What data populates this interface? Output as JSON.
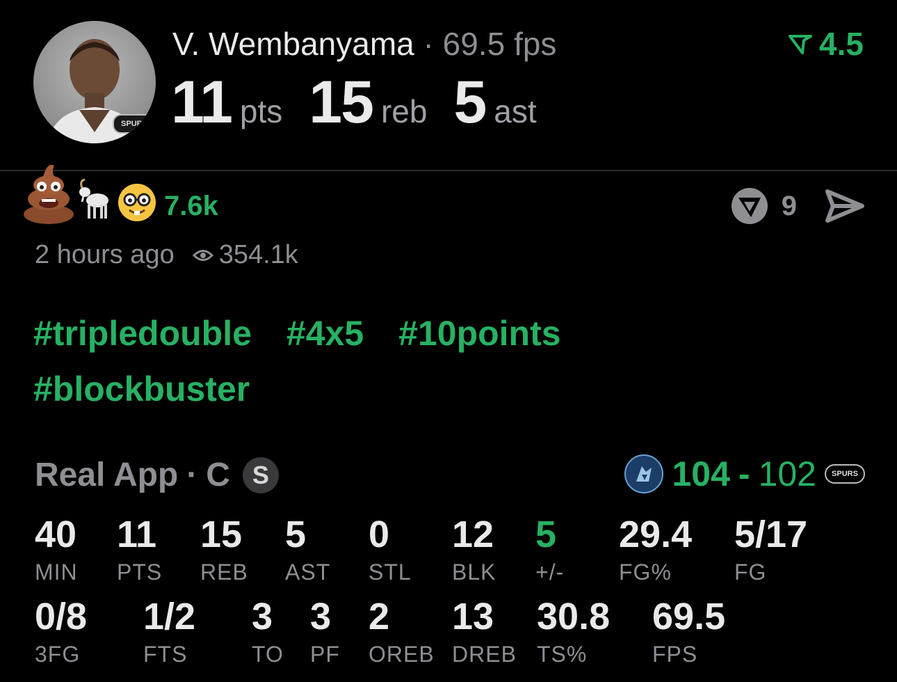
{
  "header": {
    "player_name": "V. Wembanyama",
    "separator": "·",
    "fps_label": "69.5 fps",
    "boost_value": "4.5",
    "stats": [
      {
        "value": "11",
        "unit": "pts"
      },
      {
        "value": "15",
        "unit": "reb"
      },
      {
        "value": "5",
        "unit": "ast"
      }
    ],
    "team_logo_text": "SPURS"
  },
  "reactions": {
    "emojis": [
      "poop-emoji",
      "goat-emoji",
      "nerd-emoji"
    ],
    "count": "7.6k",
    "comment_count": "9"
  },
  "meta": {
    "time_ago": "2 hours ago",
    "views": "354.1k"
  },
  "hashtags": [
    "#tripledouble",
    "#4x5",
    "#10points",
    "#blockbuster"
  ],
  "game": {
    "app": "Real App",
    "separator": "·",
    "position": "C",
    "badge": "S",
    "score_home": "104",
    "score_dash": "-",
    "score_away": "102",
    "away_logo_text": "SPURS"
  },
  "box_row1": [
    {
      "value": "40",
      "label": "MIN"
    },
    {
      "value": "11",
      "label": "PTS"
    },
    {
      "value": "15",
      "label": "REB"
    },
    {
      "value": "5",
      "label": "AST"
    },
    {
      "value": "0",
      "label": "STL"
    },
    {
      "value": "12",
      "label": "BLK"
    },
    {
      "value": "5",
      "label": "+/-"
    },
    {
      "value": "29.4",
      "label": "FG%"
    },
    {
      "value": "5/17",
      "label": "FG"
    }
  ],
  "box_row2": [
    {
      "value": "0/8",
      "label": "3FG"
    },
    {
      "value": "1/2",
      "label": "FTS"
    },
    {
      "value": "3",
      "label": "TO"
    },
    {
      "value": "3",
      "label": "PF"
    },
    {
      "value": "2",
      "label": "OREB"
    },
    {
      "value": "13",
      "label": "DREB"
    },
    {
      "value": "30.8",
      "label": "TS%"
    },
    {
      "value": "69.5",
      "label": "FPS"
    }
  ],
  "colors": {
    "accent_green": "#27b163",
    "muted_gray": "#8e8e93",
    "background": "#000000"
  }
}
